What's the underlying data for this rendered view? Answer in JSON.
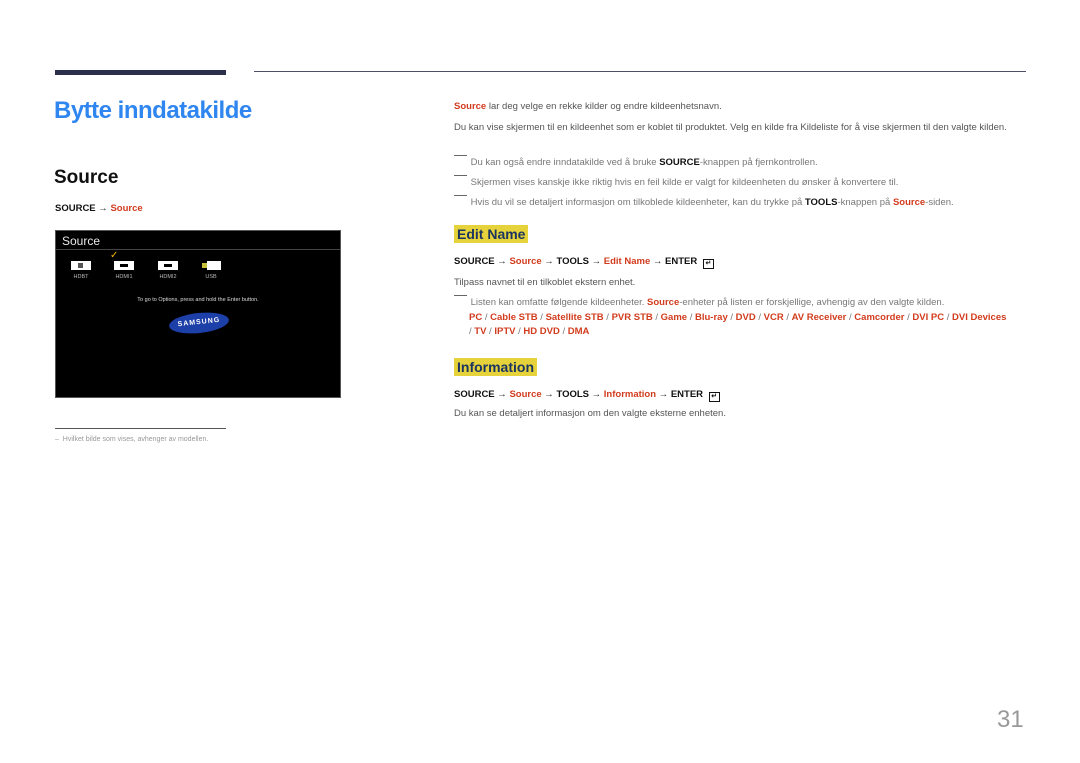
{
  "page": {
    "title": "Bytte inndatakilde",
    "section_heading": "Source",
    "page_number": "31"
  },
  "left": {
    "menu_path": {
      "root": "SOURCE",
      "arrow": "→",
      "target": "Source"
    },
    "screen": {
      "title": "Source",
      "sources": [
        {
          "label": "HDBT",
          "icon": "ethernet-port-icon",
          "selected": false
        },
        {
          "label": "HDMI1",
          "icon": "hdmi-port-icon",
          "selected": true
        },
        {
          "label": "HDMI2",
          "icon": "hdmi-port-icon",
          "selected": false
        },
        {
          "label": "USB",
          "icon": "usb-drive-icon",
          "selected": false
        }
      ],
      "selected_mark": "✓",
      "hint": "To go to Options, press and hold the Enter button.",
      "logo": "SAMSUNG"
    },
    "footnote": "Hvilket bilde som vises, avhenger av modellen."
  },
  "right": {
    "intro": {
      "lead_link": "Source",
      "lead_rest": " lar deg velge en rekke kilder og endre kildeenhetsnavn.",
      "para2": "Du kan vise skjermen til en kildeenhet som er koblet til produktet. Velg en kilde fra Kildeliste for å vise skjermen til den valgte kilden."
    },
    "notes": [
      {
        "pre": "Du kan også endre inndatakilde ved å bruke ",
        "bold": "SOURCE",
        "post": "-knappen på fjernkontrollen."
      },
      {
        "pre": "Skjermen vises kanskje ikke riktig hvis en feil kilde er valgt for kildeenheten du ønsker å konvertere til."
      },
      {
        "pre": "Hvis du vil se detaljert informasjon om tilkoblede kildeenheter, kan du trykke på ",
        "bold": "TOOLS",
        "mid": "-knappen på ",
        "link": "Source",
        "post": "-siden."
      }
    ],
    "edit_name": {
      "heading": "Edit Name",
      "path": [
        "SOURCE",
        "Source",
        "TOOLS",
        "Edit Name",
        "ENTER"
      ],
      "arrow": "→",
      "enter_icon": "↵",
      "description": "Tilpass navnet til en tilkoblet ekstern enhet.",
      "note_pre": "Listen kan omfatte følgende kildeenheter. ",
      "note_link": "Source",
      "note_post": "-enheter på listen er forskjellige, avhengig av den valgte kilden.",
      "devices": [
        "PC",
        "Cable STB",
        "Satellite STB",
        "PVR STB",
        "Game",
        "Blu-ray",
        "DVD",
        "VCR",
        "AV Receiver",
        "Camcorder",
        "DVI PC",
        "DVI Devices",
        "TV",
        "IPTV",
        "HD DVD",
        "DMA"
      ],
      "separator": " / "
    },
    "information": {
      "heading": "Information",
      "path": [
        "SOURCE",
        "Source",
        "TOOLS",
        "Information",
        "ENTER"
      ],
      "arrow": "→",
      "enter_icon": "↵",
      "description": "Du kan se detaljert informasjon om den valgte eksterne enheten."
    }
  },
  "colors": {
    "title_blue": "#2f86f0",
    "link_red": "#d23c1e",
    "highlight_yellow": "#e6d23a",
    "rule_navy": "#2b2f4a"
  }
}
